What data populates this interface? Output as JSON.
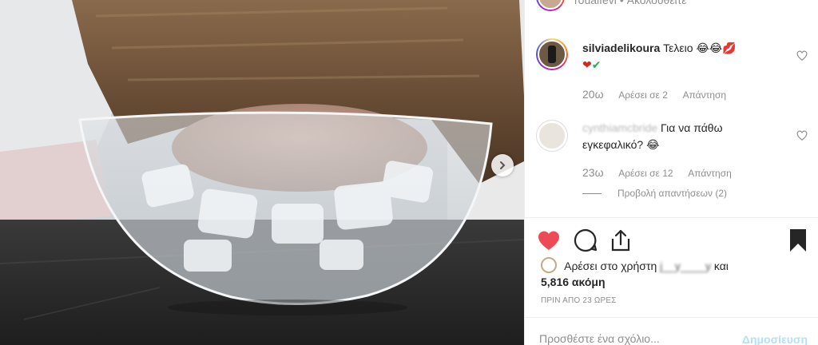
{
  "header": {
    "username": "rouaifevi",
    "follow_label": "Ακολουθείτε",
    "separator": "•"
  },
  "comments": [
    {
      "username": "silviadelikoura",
      "text": "Τελειο",
      "emojis": [
        "😂",
        "😂",
        "💋",
        "❤",
        "✔"
      ],
      "time": "20ω",
      "likes": "Αρέσει σε 2",
      "reply_label": "Απάντηση"
    },
    {
      "username": "cynthiamcbride",
      "text": "Για να πάθω εγκεφαλικό?",
      "emojis": [
        "😂"
      ],
      "time": "23ω",
      "likes": "Αρέσει σε 12",
      "reply_label": "Απάντηση",
      "view_replies": "Προβολή απαντήσεων (2)"
    }
  ],
  "actions": {
    "like_icon": "heart-filled-icon",
    "comment_icon": "comment-icon",
    "share_icon": "share-icon",
    "save_icon": "bookmark-filled-icon",
    "like_color": "#ed4956"
  },
  "likes": {
    "prefix": "Αρέσει στο χρήστη",
    "blurred_user": "j__y____y",
    "conjunction": "και",
    "count": "5,816 ακόμη"
  },
  "timestamp": "ΠΡΙΝ ΑΠΟ 23 ΩΡΕΣ",
  "add_comment": {
    "placeholder": "Προσθέστε ένα σχόλιο...",
    "post_label": "Δημοσίευση"
  },
  "carousel": {
    "next_icon": "chevron-right-icon"
  }
}
